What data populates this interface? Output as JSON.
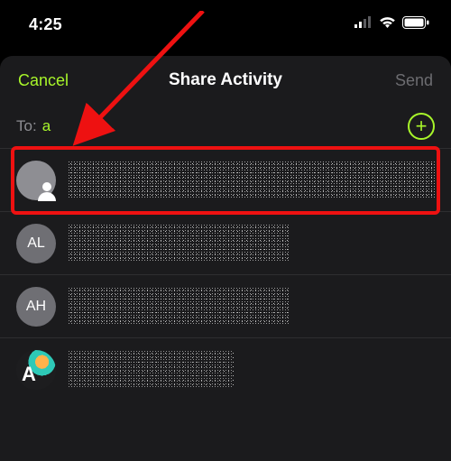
{
  "status": {
    "time": "4:25"
  },
  "nav": {
    "cancel": "Cancel",
    "title": "Share Activity",
    "send": "Send"
  },
  "to": {
    "label": "To:",
    "value": "a",
    "placeholder": ""
  },
  "icons": {
    "add": "+",
    "silhouette": "person-icon"
  },
  "contacts": {
    "items": [
      {
        "avatar_kind": "silhouette",
        "initials": ""
      },
      {
        "avatar_kind": "initials",
        "initials": "AL"
      },
      {
        "avatar_kind": "initials",
        "initials": "AH"
      },
      {
        "avatar_kind": "photo",
        "initials": "A"
      }
    ]
  },
  "colors": {
    "accent": "#a8f62a",
    "disabled": "#6c6c70",
    "annotation": "#e11"
  }
}
